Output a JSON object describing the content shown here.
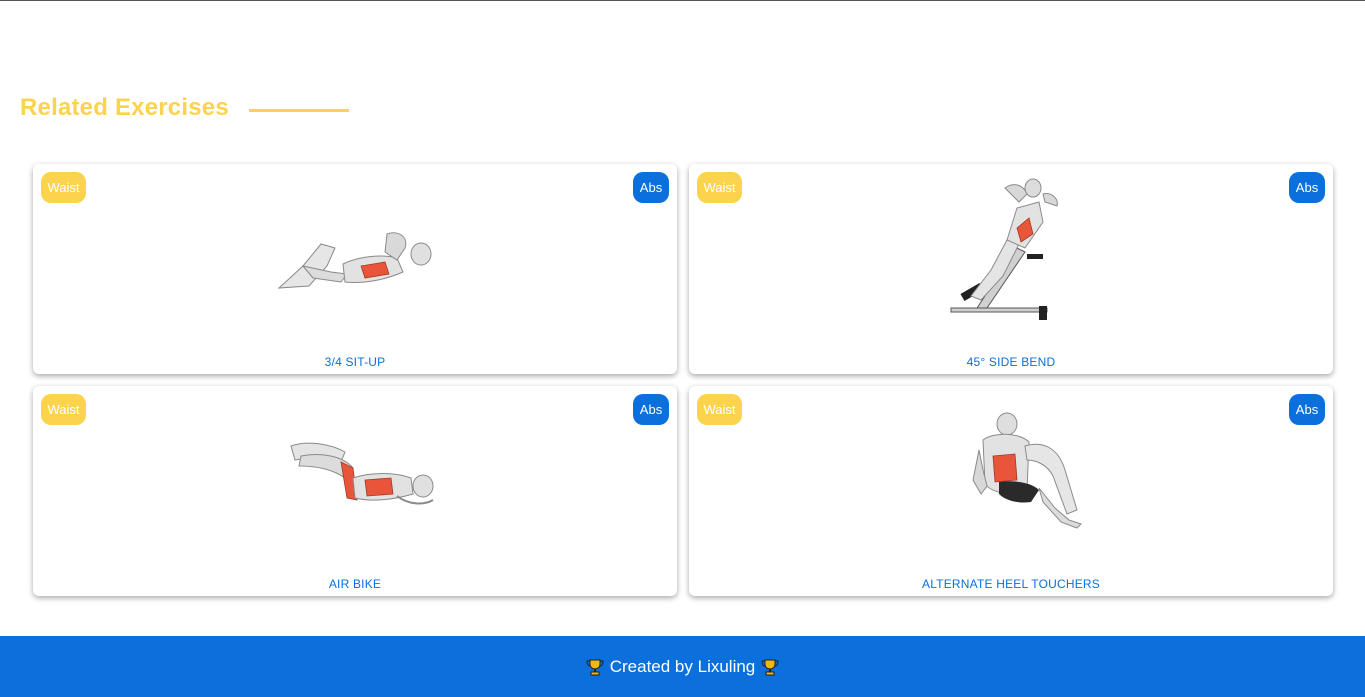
{
  "section": {
    "title": "Related Exercises"
  },
  "cards": [
    {
      "body_part": "Waist",
      "target": "Abs",
      "name": "3/4 SIT-UP"
    },
    {
      "body_part": "Waist",
      "target": "Abs",
      "name": "45° SIDE BEND"
    },
    {
      "body_part": "Waist",
      "target": "Abs",
      "name": "AIR BIKE"
    },
    {
      "body_part": "Waist",
      "target": "Abs",
      "name": "ALTERNATE HEEL TOUCHERS"
    }
  ],
  "footer": {
    "text": "Created by Lixuling",
    "icon": "trophy-icon"
  },
  "colors": {
    "accent_yellow": "#fcd34d",
    "brand_blue": "#0b6fdc",
    "muscle_red": "#e8553a"
  }
}
